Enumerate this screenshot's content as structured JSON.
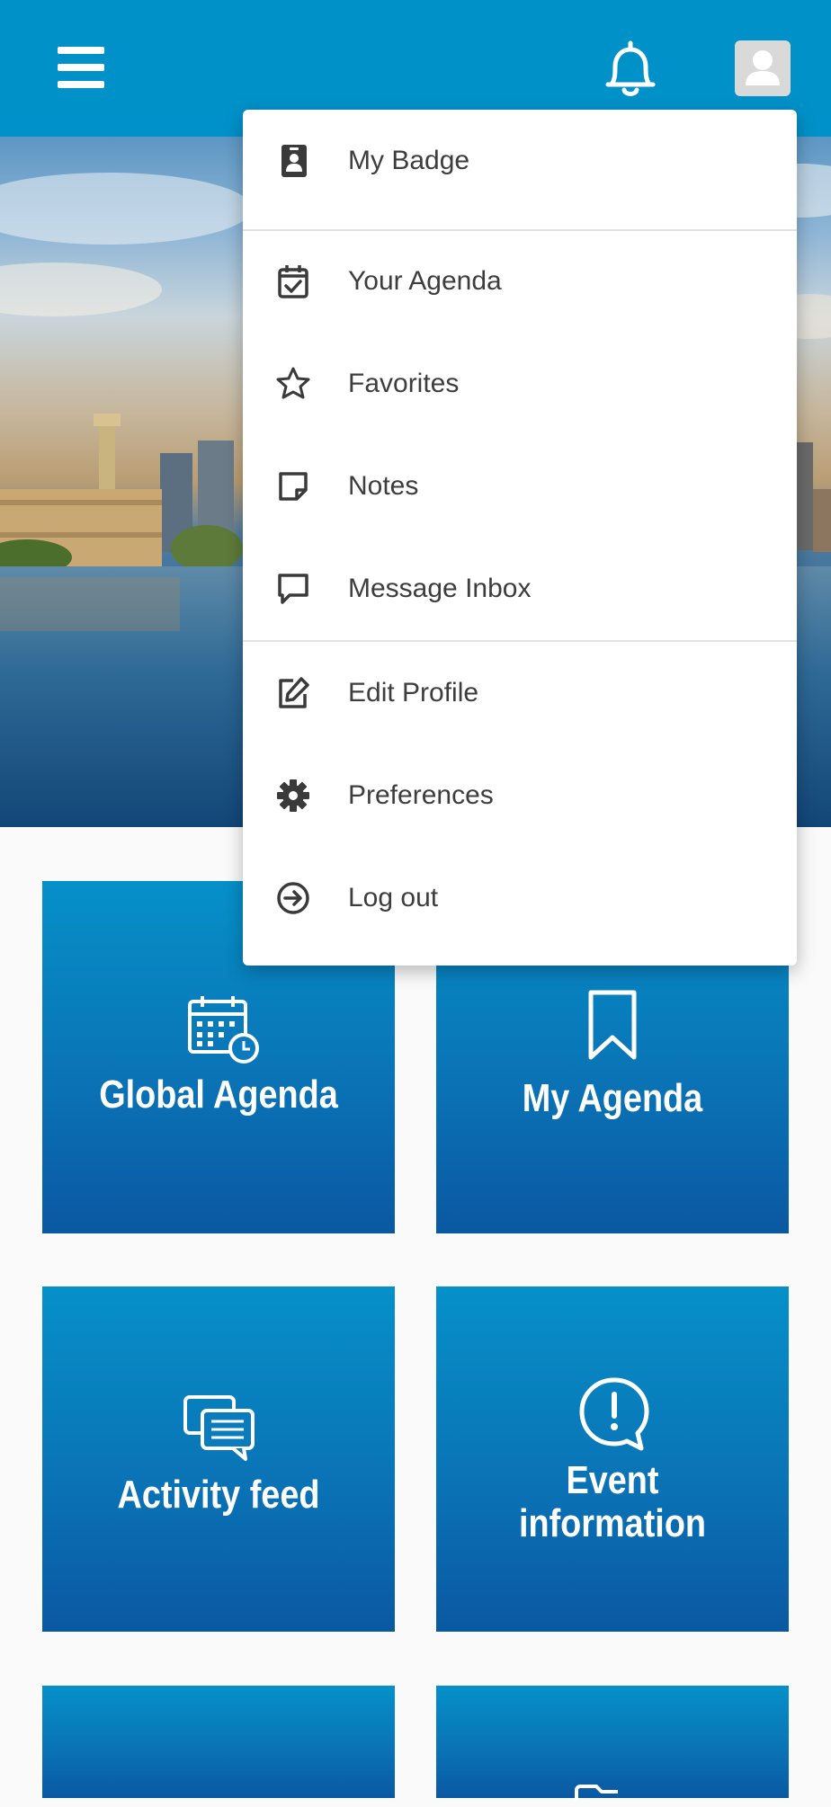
{
  "header": {
    "menu_icon": "hamburger-menu-icon",
    "notification_icon": "bell-icon",
    "avatar_icon": "user-avatar-icon",
    "background_color": "#0091c9"
  },
  "dropdown": {
    "items": [
      {
        "label": "My Badge",
        "icon": "badge-icon"
      },
      {
        "label": "Your Agenda",
        "icon": "calendar-check-icon"
      },
      {
        "label": "Favorites",
        "icon": "star-icon"
      },
      {
        "label": "Notes",
        "icon": "note-icon"
      },
      {
        "label": "Message Inbox",
        "icon": "chat-bubble-icon"
      },
      {
        "label": "Edit Profile",
        "icon": "edit-icon"
      },
      {
        "label": "Preferences",
        "icon": "gear-icon"
      },
      {
        "label": "Log out",
        "icon": "logout-icon"
      }
    ]
  },
  "tiles": [
    {
      "label": "Global Agenda",
      "icon": "calendar-clock-icon"
    },
    {
      "label": "My Agenda",
      "icon": "bookmark-icon"
    },
    {
      "label": "Activity feed",
      "icon": "chat-bubbles-icon"
    },
    {
      "label_line1": "Event",
      "label_line2": "information",
      "icon": "exclamation-bubble-icon"
    }
  ],
  "colors": {
    "tile_top": "#0690c9",
    "tile_bottom": "#0a58a2",
    "menu_text": "#3d3d3d"
  }
}
